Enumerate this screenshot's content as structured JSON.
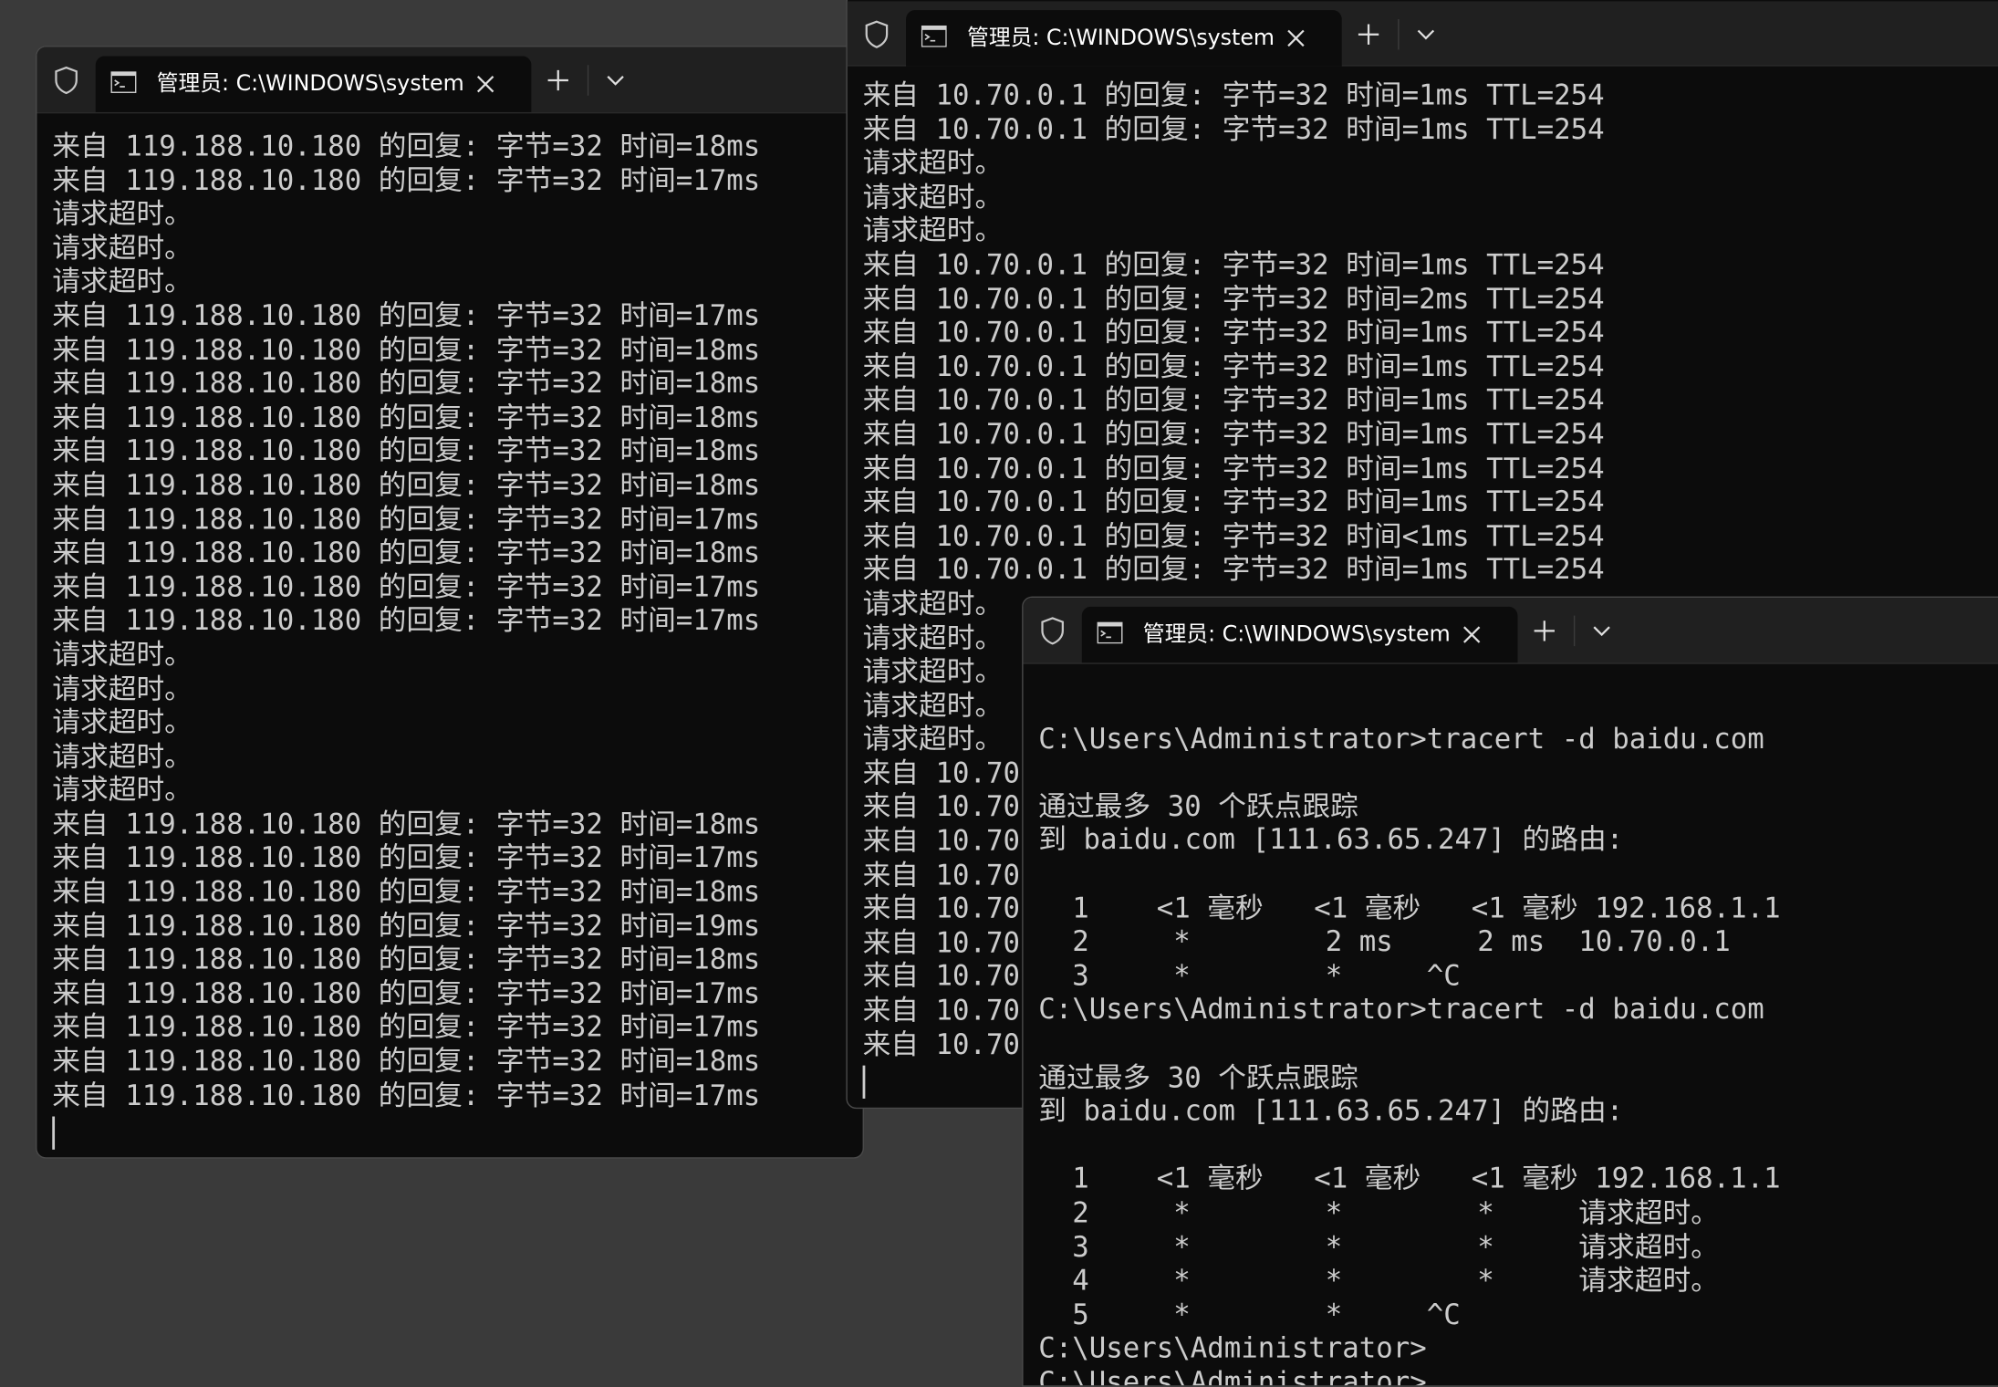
{
  "icons": {
    "shield": "shield-icon",
    "cmd": "cmd-prompt-icon",
    "close": "close-icon",
    "new_tab": "plus-icon",
    "dropdown": "chevron-down-icon"
  },
  "windows": {
    "left": {
      "tab_title": "管理员: C:\\WINDOWS\\system",
      "lines": [
        "来自 119.188.10.180 的回复: 字节=32 时间=18ms",
        "来自 119.188.10.180 的回复: 字节=32 时间=17ms",
        "请求超时。",
        "请求超时。",
        "请求超时。",
        "来自 119.188.10.180 的回复: 字节=32 时间=17ms",
        "来自 119.188.10.180 的回复: 字节=32 时间=18ms",
        "来自 119.188.10.180 的回复: 字节=32 时间=18ms",
        "来自 119.188.10.180 的回复: 字节=32 时间=18ms",
        "来自 119.188.10.180 的回复: 字节=32 时间=18ms",
        "来自 119.188.10.180 的回复: 字节=32 时间=18ms",
        "来自 119.188.10.180 的回复: 字节=32 时间=17ms",
        "来自 119.188.10.180 的回复: 字节=32 时间=18ms",
        "来自 119.188.10.180 的回复: 字节=32 时间=17ms",
        "来自 119.188.10.180 的回复: 字节=32 时间=17ms",
        "请求超时。",
        "请求超时。",
        "请求超时。",
        "请求超时。",
        "请求超时。",
        "来自 119.188.10.180 的回复: 字节=32 时间=18ms",
        "来自 119.188.10.180 的回复: 字节=32 时间=17ms",
        "来自 119.188.10.180 的回复: 字节=32 时间=18ms",
        "来自 119.188.10.180 的回复: 字节=32 时间=19ms",
        "来自 119.188.10.180 的回复: 字节=32 时间=18ms",
        "来自 119.188.10.180 的回复: 字节=32 时间=17ms",
        "来自 119.188.10.180 的回复: 字节=32 时间=17ms",
        "来自 119.188.10.180 的回复: 字节=32 时间=18ms",
        "来自 119.188.10.180 的回复: 字节=32 时间=17ms"
      ]
    },
    "top_right": {
      "tab_title": "管理员: C:\\WINDOWS\\system",
      "lines": [
        "来自 10.70.0.1 的回复: 字节=32 时间=1ms TTL=254",
        "来自 10.70.0.1 的回复: 字节=32 时间=1ms TTL=254",
        "请求超时。",
        "请求超时。",
        "请求超时。",
        "来自 10.70.0.1 的回复: 字节=32 时间=1ms TTL=254",
        "来自 10.70.0.1 的回复: 字节=32 时间=2ms TTL=254",
        "来自 10.70.0.1 的回复: 字节=32 时间=1ms TTL=254",
        "来自 10.70.0.1 的回复: 字节=32 时间=1ms TTL=254",
        "来自 10.70.0.1 的回复: 字节=32 时间=1ms TTL=254",
        "来自 10.70.0.1 的回复: 字节=32 时间=1ms TTL=254",
        "来自 10.70.0.1 的回复: 字节=32 时间=1ms TTL=254",
        "来自 10.70.0.1 的回复: 字节=32 时间=1ms TTL=254",
        "来自 10.70.0.1 的回复: 字节=32 时间<1ms TTL=254",
        "来自 10.70.0.1 的回复: 字节=32 时间=1ms TTL=254",
        "请求超时。",
        "请求超时。",
        "请求超时。",
        "请求超时。",
        "请求超时。",
        "来自 10.70",
        "来自 10.70",
        "来自 10.70",
        "来自 10.70",
        "来自 10.70",
        "来自 10.70",
        "来自 10.70",
        "来自 10.70",
        "来自 10.70"
      ]
    },
    "bottom_right": {
      "tab_title": "管理员: C:\\WINDOWS\\system",
      "lines": [
        "",
        "C:\\Users\\Administrator>tracert -d baidu.com",
        "",
        "通过最多 30 个跃点跟踪",
        "到 baidu.com [111.63.65.247] 的路由:",
        "",
        "  1    <1 毫秒   <1 毫秒   <1 毫秒 192.168.1.1",
        "  2     *        2 ms     2 ms  10.70.0.1",
        "  3     *        *     ^C",
        "C:\\Users\\Administrator>tracert -d baidu.com",
        "",
        "通过最多 30 个跃点跟踪",
        "到 baidu.com [111.63.65.247] 的路由:",
        "",
        "  1    <1 毫秒   <1 毫秒   <1 毫秒 192.168.1.1",
        "  2     *        *        *     请求超时。",
        "  3     *        *        *     请求超时。",
        "  4     *        *        *     请求超时。",
        "  5     *        *     ^C",
        "C:\\Users\\Administrator>",
        "C:\\Users\\Administrator>"
      ]
    }
  }
}
